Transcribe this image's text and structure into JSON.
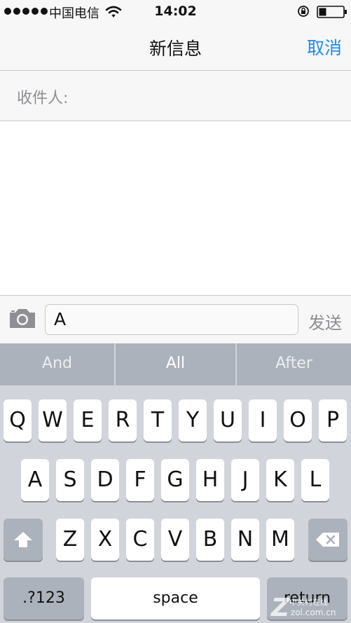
{
  "status_bar": {
    "carrier": "中国电信",
    "time": "14:02"
  },
  "nav": {
    "title": "新信息",
    "cancel_label": "取消"
  },
  "recipient": {
    "label": "收件人:",
    "value": ""
  },
  "compose": {
    "text": "A",
    "send_label": "发送"
  },
  "keyboard": {
    "suggestions": [
      "And",
      "All",
      "After"
    ],
    "selected_suggestion": "All",
    "row1": [
      "Q",
      "W",
      "E",
      "R",
      "T",
      "Y",
      "U",
      "I",
      "O",
      "P"
    ],
    "row2": [
      "A",
      "S",
      "D",
      "F",
      "G",
      "H",
      "J",
      "K",
      "L"
    ],
    "row3": [
      "Z",
      "X",
      "C",
      "V",
      "B",
      "N",
      "M"
    ],
    "numbers_label": ".?123",
    "space_label": "space",
    "return_label": "return"
  },
  "watermark": {
    "name": "中关村在线",
    "url": "zol.com.cn"
  },
  "colors": {
    "accent": "#1a8cf0",
    "keyboard_bg": "#d1d5db",
    "suggestion_bar": "#abb2bc"
  },
  "icons": {
    "wifi": "wifi-icon",
    "lock": "rotation-lock-icon",
    "battery": "battery-icon",
    "camera": "camera-icon",
    "shift": "shift-icon",
    "delete": "delete-icon"
  }
}
